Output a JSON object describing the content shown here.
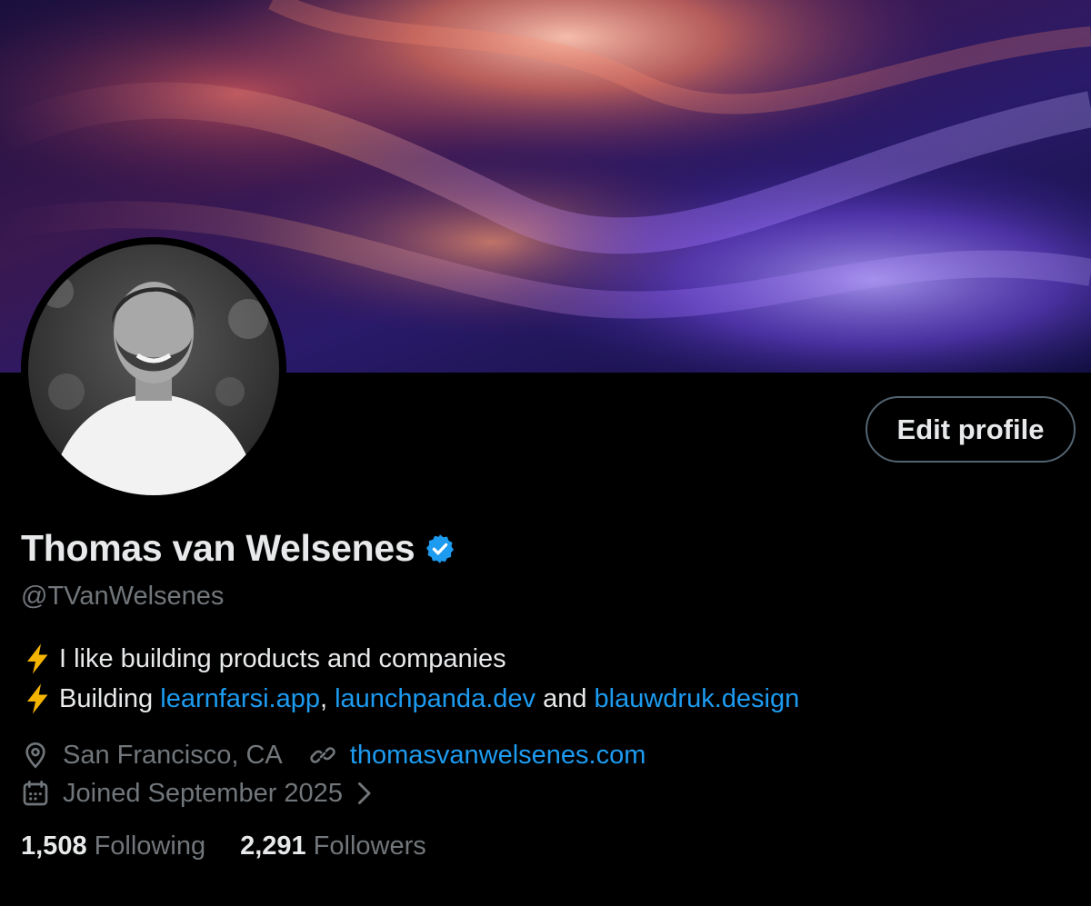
{
  "profile": {
    "display_name": "Thomas van Welsenes",
    "handle": "@TVanWelsenes",
    "edit_label": "Edit profile",
    "bio": {
      "line1": "I like building products and companies",
      "line2_prefix": "Building ",
      "link1": "learnfarsi.app",
      "sep1": ", ",
      "link2": "launchpanda.dev",
      "sep2": " and ",
      "link3": "blauwdruk.design"
    },
    "location": "San Francisco, CA",
    "website": "thomasvanwelsenes.com",
    "joined": "Joined September 2025",
    "stats": {
      "following_count": "1,508",
      "following_label": "Following",
      "followers_count": "2,291",
      "followers_label": "Followers"
    }
  },
  "icons": {
    "verified": "verified-badge-icon",
    "bio_bullet": "lightning-bolt-icon",
    "location": "location-pin-icon",
    "website": "link-icon",
    "joined": "calendar-icon",
    "joined_more": "chevron-right-icon"
  },
  "colors": {
    "background": "#000000",
    "text_primary": "#e7e9ea",
    "text_secondary": "#71767b",
    "link": "#1d9bf0",
    "button_border": "#536471",
    "verified_badge": "#1d9bf0",
    "bolt": "#f5b400"
  }
}
